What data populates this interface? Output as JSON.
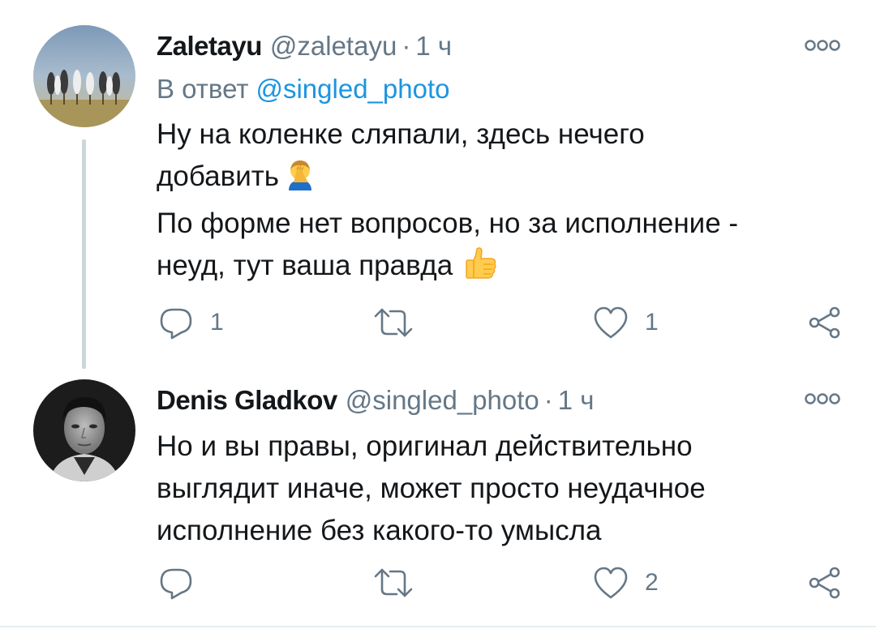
{
  "tweets": [
    {
      "display_name": "Zaletayu",
      "handle": "@zaletayu",
      "separator": "·",
      "time": "1 ч",
      "reply_prefix": "В ответ",
      "reply_mention": "@singled_photo",
      "text_lines": [
        "Ну на коленке сляпали, здесь нечего",
        "добавить",
        "По форме нет вопросов, но за исполнение -",
        "неуд, тут ваша правда"
      ],
      "emojis": [
        "face-palm-emoji",
        "thumbs-up-emoji"
      ],
      "reply_count": "1",
      "retweet_count": "",
      "like_count": "1"
    },
    {
      "display_name": "Denis Gladkov",
      "handle": "@singled_photo",
      "separator": "·",
      "time": "1 ч",
      "text_lines": [
        "Но и вы правы, оригинал действительно",
        "выглядит иначе, может просто неудачное",
        "исполнение без какого-то умысла"
      ],
      "reply_count": "",
      "retweet_count": "",
      "like_count": "2"
    }
  ],
  "icons": {
    "reply": "reply-icon",
    "retweet": "retweet-icon",
    "like": "heart-icon",
    "share": "share-icon",
    "more": "more-options-icon"
  },
  "colors": {
    "text_primary": "#14171a",
    "text_secondary": "#657786",
    "mention": "#1b95e0",
    "icon": "#657786",
    "thread_line": "#ccd6dd"
  }
}
